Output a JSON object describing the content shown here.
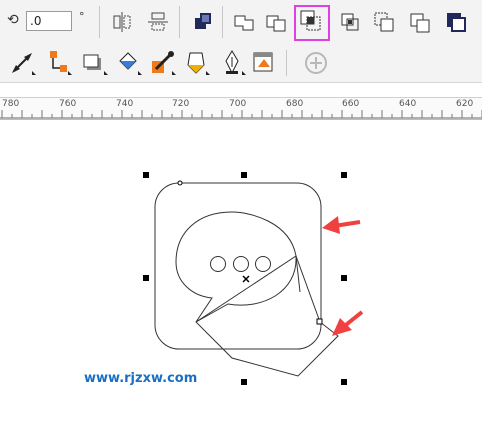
{
  "toolbar": {
    "angle_value": ".0",
    "degree_symbol": "°"
  },
  "ruler": {
    "labels": [
      "780",
      "760",
      "740",
      "720",
      "700",
      "680",
      "660",
      "640",
      "620"
    ]
  },
  "watermark": {
    "text": "www.rjzxw.com"
  },
  "icons": {
    "rotate": "rotate-icon",
    "highlight_color": "#e040e0",
    "arrow_color": "#f04040"
  }
}
